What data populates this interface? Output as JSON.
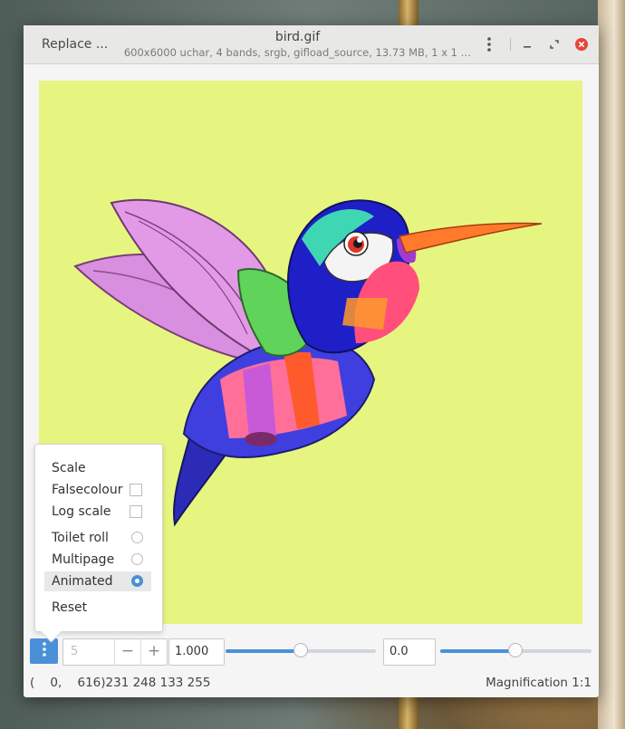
{
  "window": {
    "title": "bird.gif",
    "subtitle": "600x6000 uchar, 4 bands, srgb, gifload_source, 13.73 MB, 1 x 1 …",
    "replace_label": "Replace ...",
    "controls": [
      "kebab-menu-icon",
      "minimize-icon",
      "restore-icon",
      "close-icon"
    ],
    "close_color": "#e5453a"
  },
  "viewer": {
    "background": "#e6f57f",
    "image_description_icon": "hummingbird-image"
  },
  "toolbar": {
    "page_value": "5",
    "minus": "−",
    "plus": "+",
    "scale_value": "1.000",
    "scale_slider_fraction": 0.5,
    "offset_value": "0.0",
    "offset_slider_fraction": 0.5,
    "accent": "#4a90d9"
  },
  "status": {
    "coords": "(    0,    616)231 248 133 255",
    "magnification": "Magnification 1:1"
  },
  "menu": {
    "scale": "Scale",
    "falsecolour": "Falsecolour",
    "log_scale": "Log scale",
    "toilet_roll": "Toilet roll",
    "multipage": "Multipage",
    "animated": "Animated",
    "reset": "Reset",
    "selected_mode": "Animated"
  }
}
